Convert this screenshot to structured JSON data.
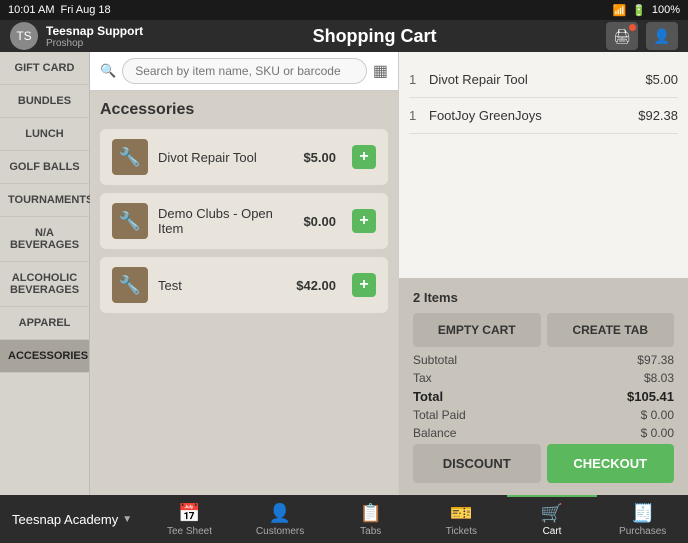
{
  "statusBar": {
    "time": "10:01 AM",
    "date": "Fri Aug 18",
    "battery": "100%",
    "icons": [
      "wifi",
      "battery"
    ]
  },
  "titleBar": {
    "userName": "Teesnap Support",
    "userRole": "Proshop",
    "pageTitle": "Shopping Cart"
  },
  "search": {
    "placeholder": "Search by item name, SKU or barcode"
  },
  "accessories": {
    "title": "Accessories",
    "products": [
      {
        "name": "Divot Repair Tool",
        "price": "$5.00"
      },
      {
        "name": "Demo Clubs - Open Item",
        "price": "$0.00"
      },
      {
        "name": "Test",
        "price": "$42.00"
      }
    ]
  },
  "sidebar": {
    "items": [
      {
        "label": "GIFT CARD"
      },
      {
        "label": "BUNDLES"
      },
      {
        "label": "LUNCH"
      },
      {
        "label": "GOLF BALLS"
      },
      {
        "label": "TOURNAMENTS"
      },
      {
        "label": "N/A BEVERAGES"
      },
      {
        "label": "ALCOHOLIC BEVERAGES"
      },
      {
        "label": "APPAREL"
      },
      {
        "label": "ACCESSORIES"
      }
    ]
  },
  "cart": {
    "itemCount": "2 Items",
    "items": [
      {
        "qty": "1",
        "name": "Divot Repair Tool",
        "price": "$5.00"
      },
      {
        "qty": "1",
        "name": "FootJoy GreenJoys",
        "price": "$92.38"
      }
    ],
    "subtotalLabel": "Subtotal",
    "subtotalValue": "$97.38",
    "taxLabel": "Tax",
    "taxValue": "$8.03",
    "totalLabel": "Total",
    "totalValue": "$105.41",
    "totalPaidLabel": "Total Paid",
    "totalPaidValue": "$ 0.00",
    "balanceLabel": "Balance",
    "balanceValue": "$ 0.00",
    "emptyCartLabel": "EMPTY CART",
    "createTabLabel": "CREATE TAB",
    "discountLabel": "DISCOUNT",
    "checkoutLabel": "CHECKOUT"
  },
  "bottomNav": {
    "storeName": "Teesnap Academy",
    "items": [
      {
        "label": "Tee Sheet",
        "icon": "📅"
      },
      {
        "label": "Customers",
        "icon": "👤"
      },
      {
        "label": "Tabs",
        "icon": "📋"
      },
      {
        "label": "Tickets",
        "icon": "🎫"
      },
      {
        "label": "Cart",
        "icon": "🛒",
        "active": true
      },
      {
        "label": "Purchases",
        "icon": "🧾"
      }
    ]
  }
}
